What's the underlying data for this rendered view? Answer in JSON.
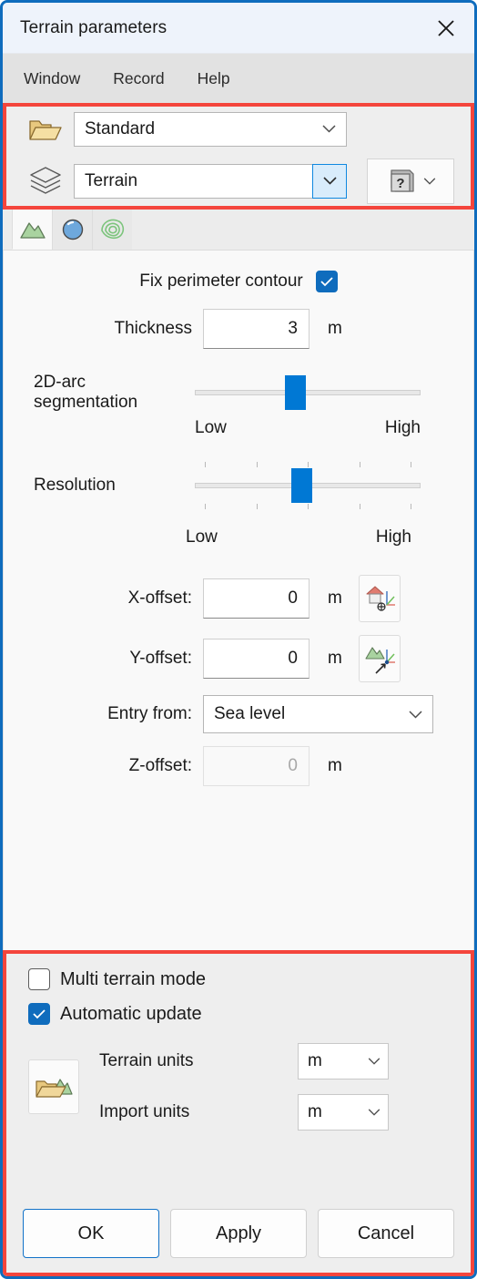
{
  "window": {
    "title": "Terrain parameters",
    "close_icon": "close-icon",
    "accent": "#0f6cbd",
    "highlight_color": "#f4453c"
  },
  "menubar": {
    "items": [
      {
        "label": "Window"
      },
      {
        "label": "Record"
      },
      {
        "label": "Help"
      }
    ]
  },
  "top_panel": {
    "folder_icon": "folder-open-icon",
    "layers_icon": "layers-icon",
    "standard_combo": {
      "value": "Standard",
      "chevron": "chevron-down-icon"
    },
    "terrain_combo": {
      "value": "Terrain",
      "chevron": "chevron-down-icon"
    },
    "help_button": {
      "icon": "help-book-icon",
      "glyph": "?",
      "chevron": "chevron-down-icon"
    }
  },
  "tabs": [
    {
      "name": "terrain-tab",
      "icon": "mountain-icon",
      "active": true
    },
    {
      "name": "sphere-tab",
      "icon": "blue-sphere-icon",
      "active": false
    },
    {
      "name": "contour-tab",
      "icon": "contour-lines-icon",
      "active": false
    }
  ],
  "main": {
    "fix_perimeter": {
      "label": "Fix perimeter contour",
      "checked": true
    },
    "thickness": {
      "label": "Thickness",
      "value": "3",
      "unit": "m"
    },
    "arc_segmentation": {
      "label_line1": "2D-arc",
      "label_line2": "segmentation",
      "value_percent": 44,
      "low": "Low",
      "high": "High"
    },
    "resolution": {
      "label": "Resolution",
      "value_percent": 47,
      "low": "Low",
      "high": "High",
      "tick_count": 5
    },
    "x_offset": {
      "label": "X-offset:",
      "value": "0",
      "unit": "m",
      "icon": "pick-house-origin-icon"
    },
    "y_offset": {
      "label": "Y-offset:",
      "value": "0",
      "unit": "m",
      "icon": "pick-terrain-point-icon"
    },
    "entry_from": {
      "label": "Entry from:",
      "value": "Sea level",
      "chevron": "chevron-down-icon"
    },
    "z_offset": {
      "label": "Z-offset:",
      "value": "0",
      "unit": "m",
      "disabled": true
    }
  },
  "bottom_panel": {
    "multi_terrain": {
      "label": "Multi terrain mode",
      "checked": false
    },
    "automatic_update": {
      "label": "Automatic update",
      "checked": true
    },
    "import_icon": "import-terrain-icon",
    "terrain_units": {
      "label": "Terrain units",
      "value": "m",
      "chevron": "chevron-down-icon"
    },
    "import_units": {
      "label": "Import units",
      "value": "m",
      "chevron": "chevron-down-icon"
    },
    "buttons": {
      "ok": "OK",
      "apply": "Apply",
      "cancel": "Cancel"
    }
  }
}
